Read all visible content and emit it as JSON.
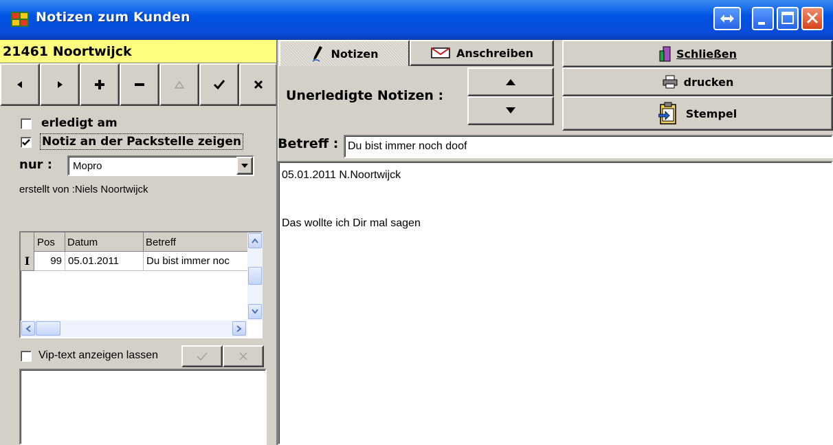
{
  "window": {
    "title": "Notizen zum Kunden"
  },
  "customer": {
    "header": "21461  Noortwijck"
  },
  "tabs": [
    {
      "label": "Notizen"
    },
    {
      "label": "Anschreiben"
    }
  ],
  "actions": {
    "close_label": "Schließen",
    "print_label": "drucken",
    "stamp_label": "Stempel"
  },
  "unerledigt": {
    "label": "Unerledigte Notizen :"
  },
  "form": {
    "erledigt_label": "erledigt am",
    "packstelle_label": "Notiz an der Packstelle zeigen",
    "nur_label": "nur :",
    "nur_value": "Mopro",
    "erstellt_label": "erstellt von :Niels Noortwijck",
    "betreff_label": "Betreff :",
    "betreff_value": "Du bist immer noch doof"
  },
  "notes_text": {
    "line1": "05.01.2011 N.Noortwijck",
    "line2": "Das wollte ich Dir mal sagen"
  },
  "grid": {
    "headers": [
      "Pos",
      "Datum",
      "Betreff"
    ],
    "rows": [
      {
        "pos": "99",
        "datum": "05.01.2011",
        "betreff": "Du bist immer noc"
      }
    ]
  },
  "vip": {
    "label": "Vip-text anzeigen lassen"
  },
  "colors": {
    "title_bar": "#0054e3",
    "customer_bg": "#ffff80",
    "face": "#d4d0c8"
  }
}
